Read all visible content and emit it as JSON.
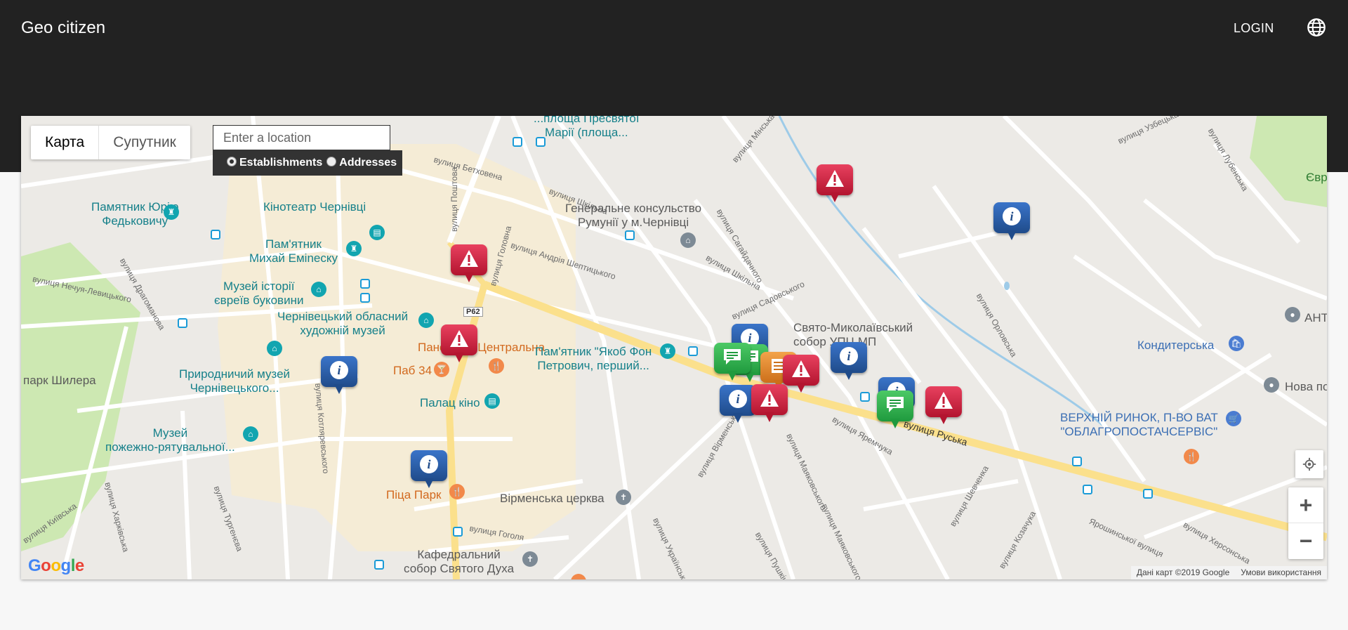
{
  "header": {
    "brand": "Geo citizen",
    "login_label": "LOGIN",
    "language_icon": "globe-icon"
  },
  "map_controls": {
    "map_type_map": "Карта",
    "map_type_satellite": "Супутник",
    "search_placeholder": "Enter a location",
    "radio_establishments": "Establishments",
    "radio_addresses": "Addresses",
    "radio_selected": "Establishments",
    "zoom_in": "+",
    "zoom_out": "−"
  },
  "map_places": {
    "monument_fedkovych": "Памятник Юрію\nФедьковичу",
    "cinema_chernivtsi": "Кінотеатр Чернівці",
    "monument_eminescu": "Пам'ятник\nМихай Еміnеску",
    "museum_jews": "Музей історії\nєвреїв буковини",
    "art_museum": "Чернівецький обласний\nхудожній музей",
    "panorama": "Панорама Центральна",
    "pub34": "Паб 34",
    "monument_jakob": "Пам'ятник \"Якоб Фон\nПетрович, перший...",
    "park_shiller": "парк Шилера",
    "nature_museum": "Природничий музей\nЧернівецького...",
    "fire_museum": "Музей\nпожежно-рятувальної...",
    "palace_cinema": "Палац кіно",
    "pizza_park": "Піца Парк",
    "armenian_church": "Вірменська церква",
    "cathedral": "Кафедральний\nсобор Святого Духа",
    "consulate": "Генеральне консульство\nРумунії у м.Чернівці",
    "cathedral_st_nicholas": "Свято-Миколаївський\nсобор УПЦ МП",
    "square": "...площа Пресвятої\nМарії (площа...",
    "confectionery": "Кондитерська",
    "market": "ВЕРХНІЙ РИНОК, П-ВО ВАТ\n\"ОБЛАГРОПОСТАЧСЕРВІС\"",
    "ant": "АНТ",
    "nova_poshta": "Нова по",
    "evr": "Євр"
  },
  "streets": {
    "holovna": "вулиця Головна",
    "russka": "вулиця Руська",
    "sahaidachnoho": "вулиця Сагайдачного",
    "sheptytskoho": "вулиця Андрія Шептицького",
    "shkilna": "вулиця Шкільна",
    "betkhovena": "вулиця Бетховена",
    "poshtova": "вулиця Поштова",
    "minska": "вулиця Мінська",
    "kotliarevskoho": "вулиця Котляревського",
    "vikrmenska": "вулиця Вірменська",
    "mayakovskoho": "вулиця Маяковського",
    "shevchenka": "вулиця Шевченка",
    "orlovska": "вулиця Орловська",
    "uzbetska": "вулиця Узбецька",
    "lubenska": "вулиця Лубенська",
    "drahomanova": "вулиця Драгоманова",
    "nechuia": "вулиця Нечуя-Левицького",
    "kharkivska": "вулиця Харківська",
    "turheneva": "вулиця Тургенєва",
    "hoholia": "вулиця Гоголя",
    "ukrainska": "вулиця Українська",
    "pushkina": "вулиця Пушкіна",
    "kozachuka": "вулиця Козачука",
    "yaremchuka": "вулиця Яремчука",
    "sadovskoho": "вулиця Садовського",
    "khersonska": "вулиця Херсонська",
    "kyivska": "вулиця Київська",
    "yaroshynskoi": "Ярошинської вулиця",
    "route": "Р62"
  },
  "markers": [
    {
      "type": "problem",
      "color": "red",
      "icon": "warning-icon"
    },
    {
      "type": "info",
      "color": "blue",
      "icon": "info-icon"
    },
    {
      "type": "problem",
      "color": "red",
      "icon": "warning-icon"
    },
    {
      "type": "problem",
      "color": "red",
      "icon": "warning-icon"
    },
    {
      "type": "info",
      "color": "blue",
      "icon": "info-icon"
    },
    {
      "type": "info",
      "color": "blue",
      "icon": "info-icon"
    },
    {
      "type": "info",
      "color": "blue",
      "icon": "info-icon"
    },
    {
      "type": "comment",
      "color": "green",
      "icon": "chat-icon"
    },
    {
      "type": "comment",
      "color": "green",
      "icon": "chat-icon"
    },
    {
      "type": "list",
      "color": "orange",
      "icon": "list-icon"
    },
    {
      "type": "problem",
      "color": "red",
      "icon": "warning-icon"
    },
    {
      "type": "info",
      "color": "blue",
      "icon": "info-icon"
    },
    {
      "type": "info",
      "color": "blue",
      "icon": "info-icon"
    },
    {
      "type": "problem",
      "color": "red",
      "icon": "warning-icon"
    },
    {
      "type": "info",
      "color": "blue",
      "icon": "info-icon"
    },
    {
      "type": "comment",
      "color": "green",
      "icon": "chat-icon"
    },
    {
      "type": "problem",
      "color": "red",
      "icon": "warning-icon"
    }
  ],
  "attribution": {
    "data": "Дані карт ©2019 Google",
    "terms": "Умови використання"
  },
  "google_logo": [
    "G",
    "o",
    "o",
    "g",
    "l",
    "e"
  ]
}
